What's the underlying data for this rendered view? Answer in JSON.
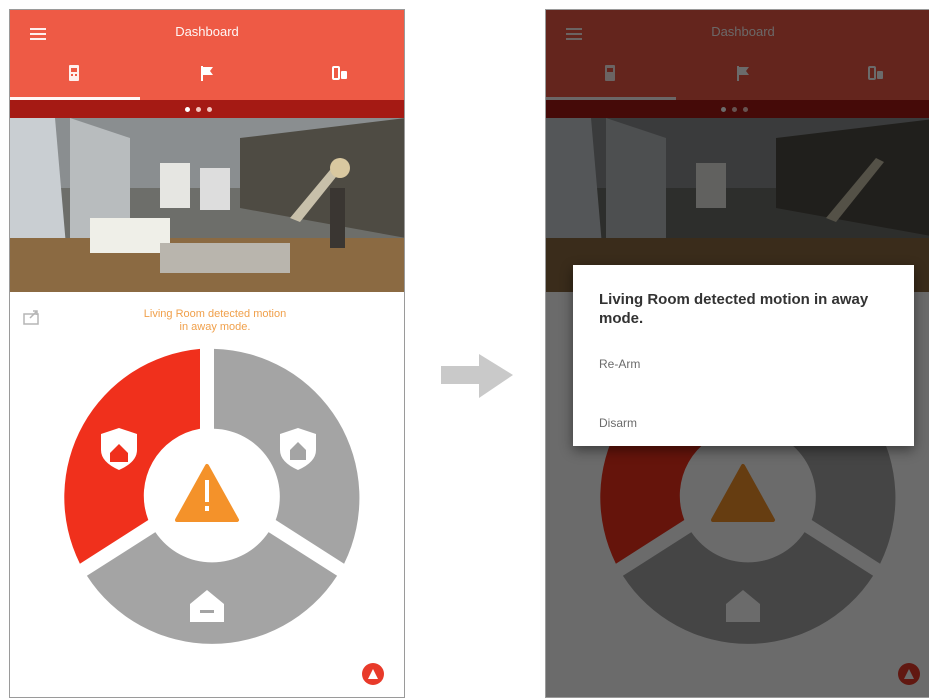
{
  "app": {
    "title": "Dashboard",
    "tabs": [
      {
        "icon": "security-panel-icon",
        "active": true
      },
      {
        "icon": "flag-icon",
        "active": false
      },
      {
        "icon": "devices-icon",
        "active": false
      }
    ],
    "status": {
      "left": "",
      "right": "",
      "page_dots": 3,
      "active_dot": 0
    },
    "camera": {
      "overlay_text": ""
    },
    "alert_text": "Living Room detected motion\nin away mode.",
    "wheel": {
      "segments": [
        {
          "name": "away",
          "icon": "away-shield-icon",
          "color": "#f0301c",
          "active": true
        },
        {
          "name": "stay",
          "icon": "stay-shield-icon",
          "color": "#a4a4a4",
          "active": false
        },
        {
          "name": "disarm",
          "icon": "disarm-house-icon",
          "color": "#a4a4a4",
          "active": false
        }
      ],
      "center_icon": "warning-icon",
      "center_color": "#f4922a"
    },
    "fab_icon": "alert-icon"
  },
  "dialog": {
    "title": "Living Room detected motion in away mode.",
    "options": [
      "Re-Arm",
      "Disarm"
    ]
  },
  "colors": {
    "primary": "#ee5a45",
    "status_strip": "#a51a14",
    "alert_text": "#f0a04b",
    "arrow": "#c9c9c9"
  }
}
